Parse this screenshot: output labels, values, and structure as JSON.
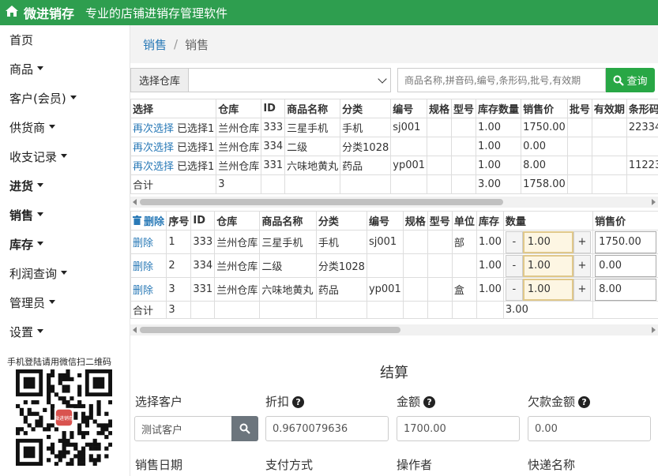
{
  "header": {
    "brand": "微进销存",
    "slogan": "专业的店铺进销存管理软件",
    "accent": "#2e9e4f"
  },
  "sidebar": {
    "items": [
      {
        "label": "首页",
        "caret": false,
        "bold": false
      },
      {
        "label": "商品",
        "caret": true,
        "bold": false
      },
      {
        "label": "客户(会员)",
        "caret": true,
        "bold": false
      },
      {
        "label": "供货商",
        "caret": true,
        "bold": false
      },
      {
        "label": "收支记录",
        "caret": true,
        "bold": false
      },
      {
        "label": "进货",
        "caret": true,
        "bold": true
      },
      {
        "label": "销售",
        "caret": true,
        "bold": true
      },
      {
        "label": "库存",
        "caret": true,
        "bold": true
      },
      {
        "label": "利润查询",
        "caret": true,
        "bold": false
      },
      {
        "label": "管理员",
        "caret": true,
        "bold": false
      },
      {
        "label": "设置",
        "caret": true,
        "bold": false
      }
    ],
    "qr_label": "手机登陆请用微信扫二维码",
    "qr_center": "微进销存"
  },
  "breadcrumb": {
    "link": "销售",
    "sep": "/",
    "current": "销售"
  },
  "search": {
    "warehouse_label": "选择仓库",
    "warehouse_value": "",
    "placeholder": "商品名称,拼音码,编号,条形码,批号,有效期",
    "button": "查询"
  },
  "results": {
    "headers": [
      "选择",
      "仓库",
      "ID",
      "商品名称",
      "分类",
      "编号",
      "规格",
      "型号",
      "库存数量",
      "销售价",
      "批号",
      "有效期",
      "条形码"
    ],
    "rows": [
      {
        "reselect": "再次选择",
        "selected": "已选择1",
        "cells": [
          "兰州仓库",
          "333",
          "三星手机",
          "手机",
          "sj001",
          "",
          "",
          "1.00",
          "1750.00",
          "",
          "",
          "22334"
        ]
      },
      {
        "reselect": "再次选择",
        "selected": "已选择1",
        "cells": [
          "兰州仓库",
          "334",
          "二级",
          "分类1028",
          "",
          "",
          "",
          "1.00",
          "0.00",
          "",
          "",
          ""
        ]
      },
      {
        "reselect": "再次选择",
        "selected": "已选择1",
        "cells": [
          "兰州仓库",
          "331",
          "六味地黄丸",
          "药品",
          "yp001",
          "",
          "",
          "1.00",
          "8.00",
          "",
          "",
          "11223"
        ]
      }
    ],
    "total": {
      "label": "合计",
      "count": "3",
      "stock": "3.00",
      "price": "1758.00"
    }
  },
  "cart": {
    "delete_all": "删除",
    "headers": [
      "序号",
      "ID",
      "仓库",
      "商品名称",
      "分类",
      "编号",
      "规格",
      "型号",
      "单位",
      "库存",
      "数量",
      "销售价"
    ],
    "rows": [
      {
        "del": "删除",
        "no": "1",
        "id": "333",
        "wh": "兰州仓库",
        "name": "三星手机",
        "cat": "手机",
        "code": "sj001",
        "spec": "",
        "model": "",
        "unit": "部",
        "stock": "1.00",
        "qty": "1.00",
        "price": "1750.00"
      },
      {
        "del": "删除",
        "no": "2",
        "id": "334",
        "wh": "兰州仓库",
        "name": "二级",
        "cat": "分类1028",
        "code": "",
        "spec": "",
        "model": "",
        "unit": "",
        "stock": "1.00",
        "qty": "1.00",
        "price": "0.00"
      },
      {
        "del": "删除",
        "no": "3",
        "id": "331",
        "wh": "兰州仓库",
        "name": "六味地黄丸",
        "cat": "药品",
        "code": "yp001",
        "spec": "",
        "model": "",
        "unit": "盒",
        "stock": "1.00",
        "qty": "1.00",
        "price": "8.00"
      }
    ],
    "total": {
      "label": "合计",
      "count": "3",
      "qty": "3.00"
    },
    "minus": "-",
    "plus": "+"
  },
  "settle": {
    "title": "结算",
    "customer_label": "选择客户",
    "customer_value": "测试客户",
    "discount_label": "折扣",
    "discount_value": "0.9670079636",
    "amount_label": "金额",
    "amount_value": "1700.00",
    "debt_label": "欠款金额",
    "debt_value": "0.00",
    "help": "?",
    "date_label": "销售日期",
    "pay_label": "支付方式",
    "operator_label": "操作者",
    "express_label": "快递名称"
  }
}
